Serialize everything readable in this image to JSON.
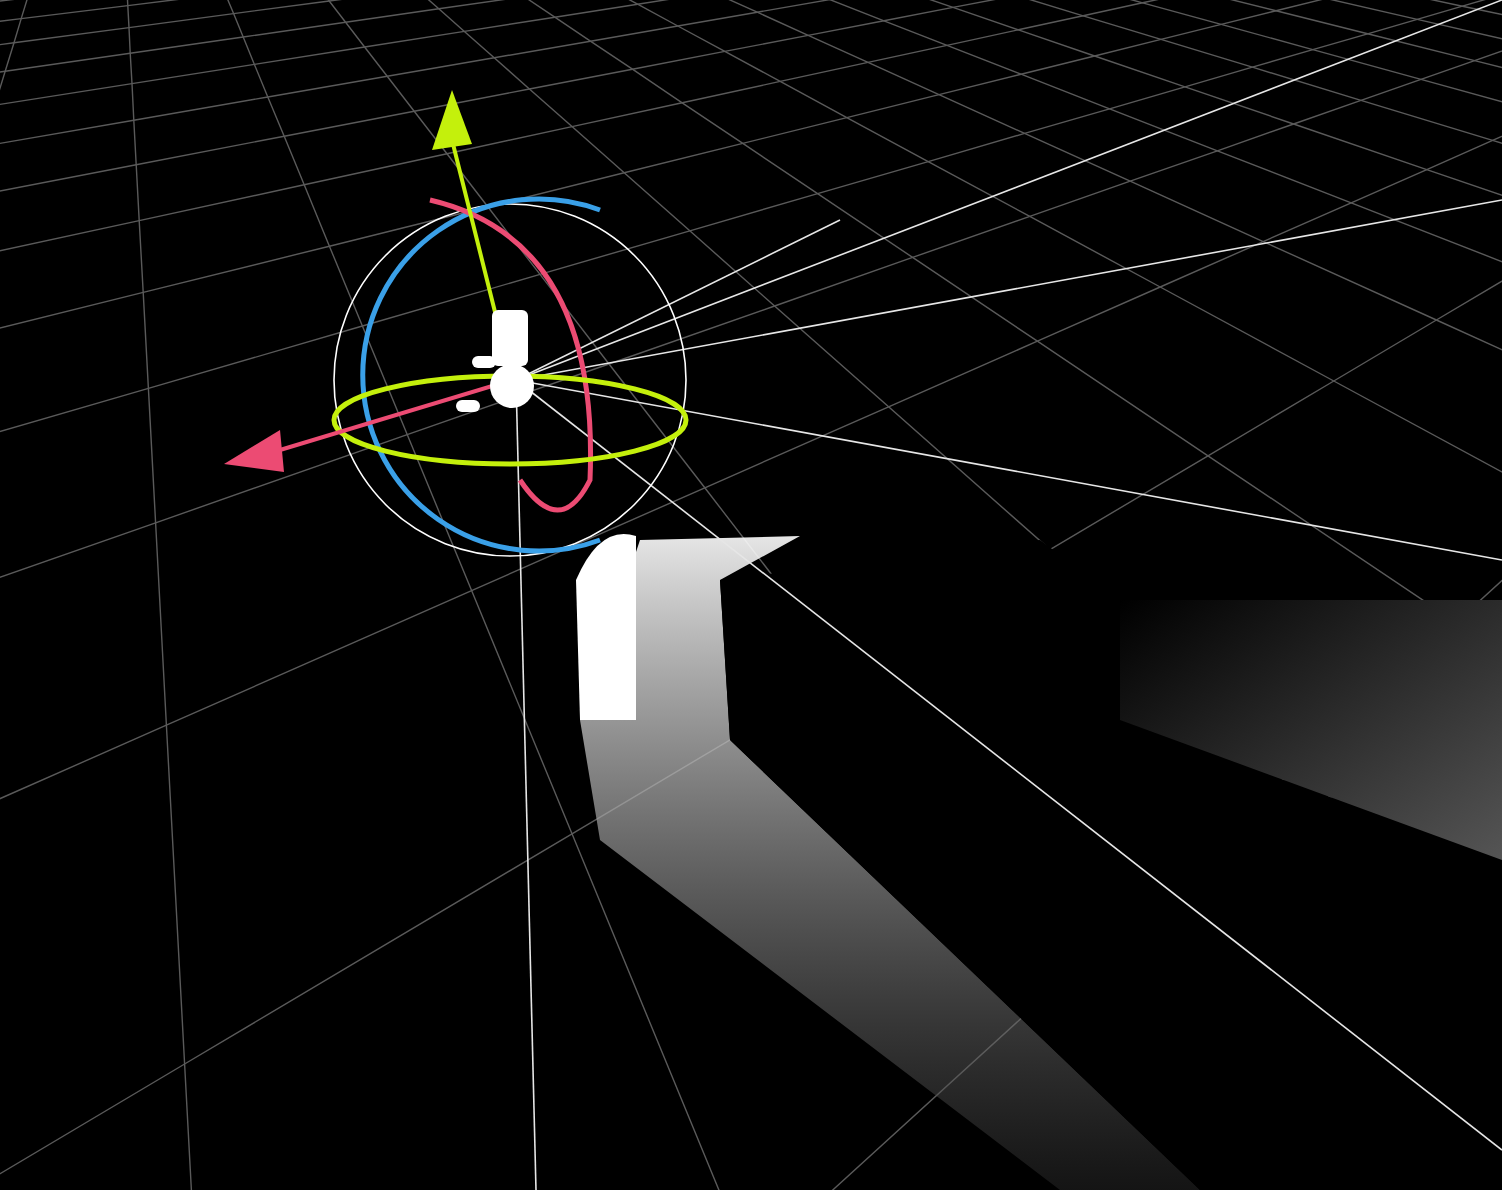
{
  "scene_view": {
    "show_grid": true,
    "show_rotation_gizmo": true
  }
}
